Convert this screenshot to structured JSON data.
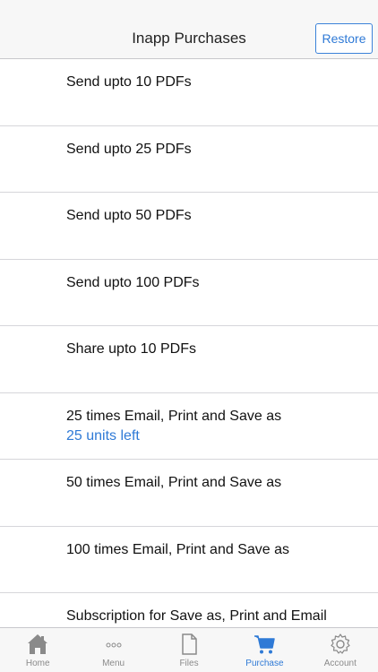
{
  "header": {
    "title": "Inapp Purchases",
    "restore_label": "Restore"
  },
  "items": [
    {
      "label": "Send upto 10 PDFs"
    },
    {
      "label": "Send upto 25 PDFs"
    },
    {
      "label": "Send upto 50 PDFs"
    },
    {
      "label": "Send upto 100 PDFs"
    },
    {
      "label": "Share upto 10 PDFs"
    },
    {
      "label": "25 times Email, Print and Save as",
      "sub": "25 units left"
    },
    {
      "label": "50 times Email, Print and Save as"
    },
    {
      "label": "100 times Email, Print and Save as"
    },
    {
      "label": "Subscription for Save as, Print and Email"
    }
  ],
  "tabs": [
    {
      "label": "Home",
      "icon": "home-icon"
    },
    {
      "label": "Menu",
      "icon": "more-icon"
    },
    {
      "label": "Files",
      "icon": "file-icon"
    },
    {
      "label": "Purchase",
      "icon": "cart-icon",
      "active": true
    },
    {
      "label": "Account",
      "icon": "gear-icon"
    }
  ],
  "colors": {
    "accent": "#2f7ad6",
    "inactive": "#8a8a8a",
    "bar": "#f7f7f7"
  }
}
